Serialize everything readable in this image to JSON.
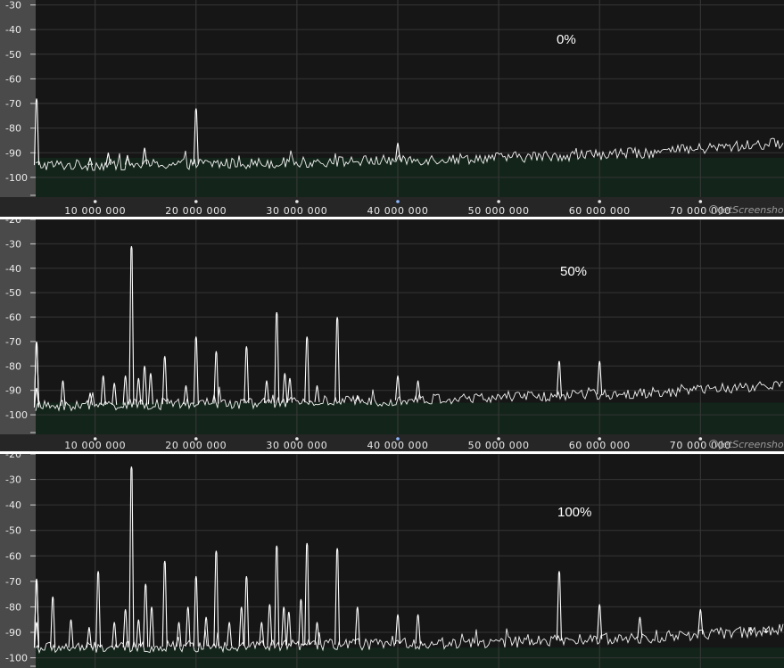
{
  "chart_data": [
    {
      "type": "line",
      "annotation": "0%",
      "y_ticks": [
        "-30",
        "-40",
        "-50",
        "-60",
        "-70",
        "-80",
        "-90",
        "-100"
      ],
      "x_ticks": [
        "10 000 000",
        "20 000 000",
        "30 000 000",
        "40 000 000",
        "50 000 000",
        "60 000 000",
        "70 000 000"
      ],
      "ylim": [
        -108,
        -28
      ],
      "xlim": [
        0,
        78000000
      ],
      "watermark": "jetScreenshot",
      "noise_floor": [
        [
          0,
          -95
        ],
        [
          10000000,
          -95
        ],
        [
          30000000,
          -94
        ],
        [
          50000000,
          -92
        ],
        [
          65000000,
          -90
        ],
        [
          78000000,
          -86
        ]
      ],
      "peaks": [
        {
          "x": 0,
          "y": -68
        },
        {
          "x": 9500000,
          "y": -92
        },
        {
          "x": 11300000,
          "y": -90
        },
        {
          "x": 13200000,
          "y": -91
        },
        {
          "x": 14900000,
          "y": -88
        },
        {
          "x": 20000000,
          "y": -72
        },
        {
          "x": 40000000,
          "y": -86
        }
      ]
    },
    {
      "type": "line",
      "annotation": "50%",
      "y_ticks": [
        "-20",
        "-30",
        "-40",
        "-50",
        "-60",
        "-70",
        "-80",
        "-90",
        "-100"
      ],
      "x_ticks": [
        "10 000 000",
        "20 000 000",
        "30 000 000",
        "40 000 000",
        "50 000 000",
        "60 000 000",
        "70 000 000"
      ],
      "ylim": [
        -108,
        -20
      ],
      "xlim": [
        0,
        78000000
      ],
      "watermark": "jetScreenshot",
      "noise_floor": [
        [
          0,
          -97
        ],
        [
          10000000,
          -96
        ],
        [
          30000000,
          -95
        ],
        [
          50000000,
          -93
        ],
        [
          65000000,
          -91
        ],
        [
          78000000,
          -88
        ]
      ],
      "peaks": [
        {
          "x": 0,
          "y": -70
        },
        {
          "x": 1900000,
          "y": -71
        },
        {
          "x": 4000000,
          "y": -89
        },
        {
          "x": 6800000,
          "y": -86
        },
        {
          "x": 9500000,
          "y": -91
        },
        {
          "x": 10800000,
          "y": -84
        },
        {
          "x": 11900000,
          "y": -87
        },
        {
          "x": 13000000,
          "y": -84
        },
        {
          "x": 13600000,
          "y": -31
        },
        {
          "x": 14300000,
          "y": -85
        },
        {
          "x": 14900000,
          "y": -80
        },
        {
          "x": 15500000,
          "y": -83
        },
        {
          "x": 16900000,
          "y": -76
        },
        {
          "x": 19000000,
          "y": -88
        },
        {
          "x": 20000000,
          "y": -68
        },
        {
          "x": 22000000,
          "y": -74
        },
        {
          "x": 25000000,
          "y": -72
        },
        {
          "x": 27000000,
          "y": -86
        },
        {
          "x": 28000000,
          "y": -58
        },
        {
          "x": 28800000,
          "y": -83
        },
        {
          "x": 29300000,
          "y": -85
        },
        {
          "x": 31000000,
          "y": -68
        },
        {
          "x": 32000000,
          "y": -88
        },
        {
          "x": 34000000,
          "y": -60
        },
        {
          "x": 36000000,
          "y": -92
        },
        {
          "x": 40000000,
          "y": -84
        },
        {
          "x": 42000000,
          "y": -86
        },
        {
          "x": 56000000,
          "y": -78
        },
        {
          "x": 60000000,
          "y": -78
        }
      ]
    },
    {
      "type": "line",
      "annotation": "100%",
      "y_ticks": [
        "-20",
        "-30",
        "-40",
        "-50",
        "-60",
        "-70",
        "-80",
        "-90",
        "-100"
      ],
      "x_ticks": [],
      "ylim": [
        -104,
        -20
      ],
      "xlim": [
        0,
        78000000
      ],
      "watermark": "",
      "noise_floor": [
        [
          0,
          -96
        ],
        [
          10000000,
          -96
        ],
        [
          30000000,
          -95
        ],
        [
          50000000,
          -94
        ],
        [
          65000000,
          -92
        ],
        [
          78000000,
          -89
        ]
      ],
      "peaks": [
        {
          "x": 0,
          "y": -70
        },
        {
          "x": 1900000,
          "y": -69
        },
        {
          "x": 3900000,
          "y": -86
        },
        {
          "x": 5800000,
          "y": -76
        },
        {
          "x": 7600000,
          "y": -85
        },
        {
          "x": 9400000,
          "y": -88
        },
        {
          "x": 10300000,
          "y": -66
        },
        {
          "x": 11900000,
          "y": -86
        },
        {
          "x": 13000000,
          "y": -81
        },
        {
          "x": 13600000,
          "y": -25
        },
        {
          "x": 14300000,
          "y": -85
        },
        {
          "x": 15000000,
          "y": -71
        },
        {
          "x": 15600000,
          "y": -80
        },
        {
          "x": 16900000,
          "y": -62
        },
        {
          "x": 18300000,
          "y": -86
        },
        {
          "x": 19200000,
          "y": -80
        },
        {
          "x": 20000000,
          "y": -68
        },
        {
          "x": 21000000,
          "y": -84
        },
        {
          "x": 22000000,
          "y": -58
        },
        {
          "x": 23300000,
          "y": -86
        },
        {
          "x": 24500000,
          "y": -80
        },
        {
          "x": 25000000,
          "y": -68
        },
        {
          "x": 26500000,
          "y": -86
        },
        {
          "x": 27300000,
          "y": -79
        },
        {
          "x": 28000000,
          "y": -56
        },
        {
          "x": 28700000,
          "y": -80
        },
        {
          "x": 29200000,
          "y": -82
        },
        {
          "x": 30400000,
          "y": -77
        },
        {
          "x": 31000000,
          "y": -55
        },
        {
          "x": 32000000,
          "y": -86
        },
        {
          "x": 34000000,
          "y": -57
        },
        {
          "x": 36000000,
          "y": -80
        },
        {
          "x": 40000000,
          "y": -83
        },
        {
          "x": 42000000,
          "y": -83
        },
        {
          "x": 56000000,
          "y": -66
        },
        {
          "x": 60000000,
          "y": -79
        },
        {
          "x": 64000000,
          "y": -84
        },
        {
          "x": 70000000,
          "y": -81
        },
        {
          "x": 75000000,
          "y": -88
        },
        {
          "x": 76500000,
          "y": -89
        }
      ]
    }
  ]
}
